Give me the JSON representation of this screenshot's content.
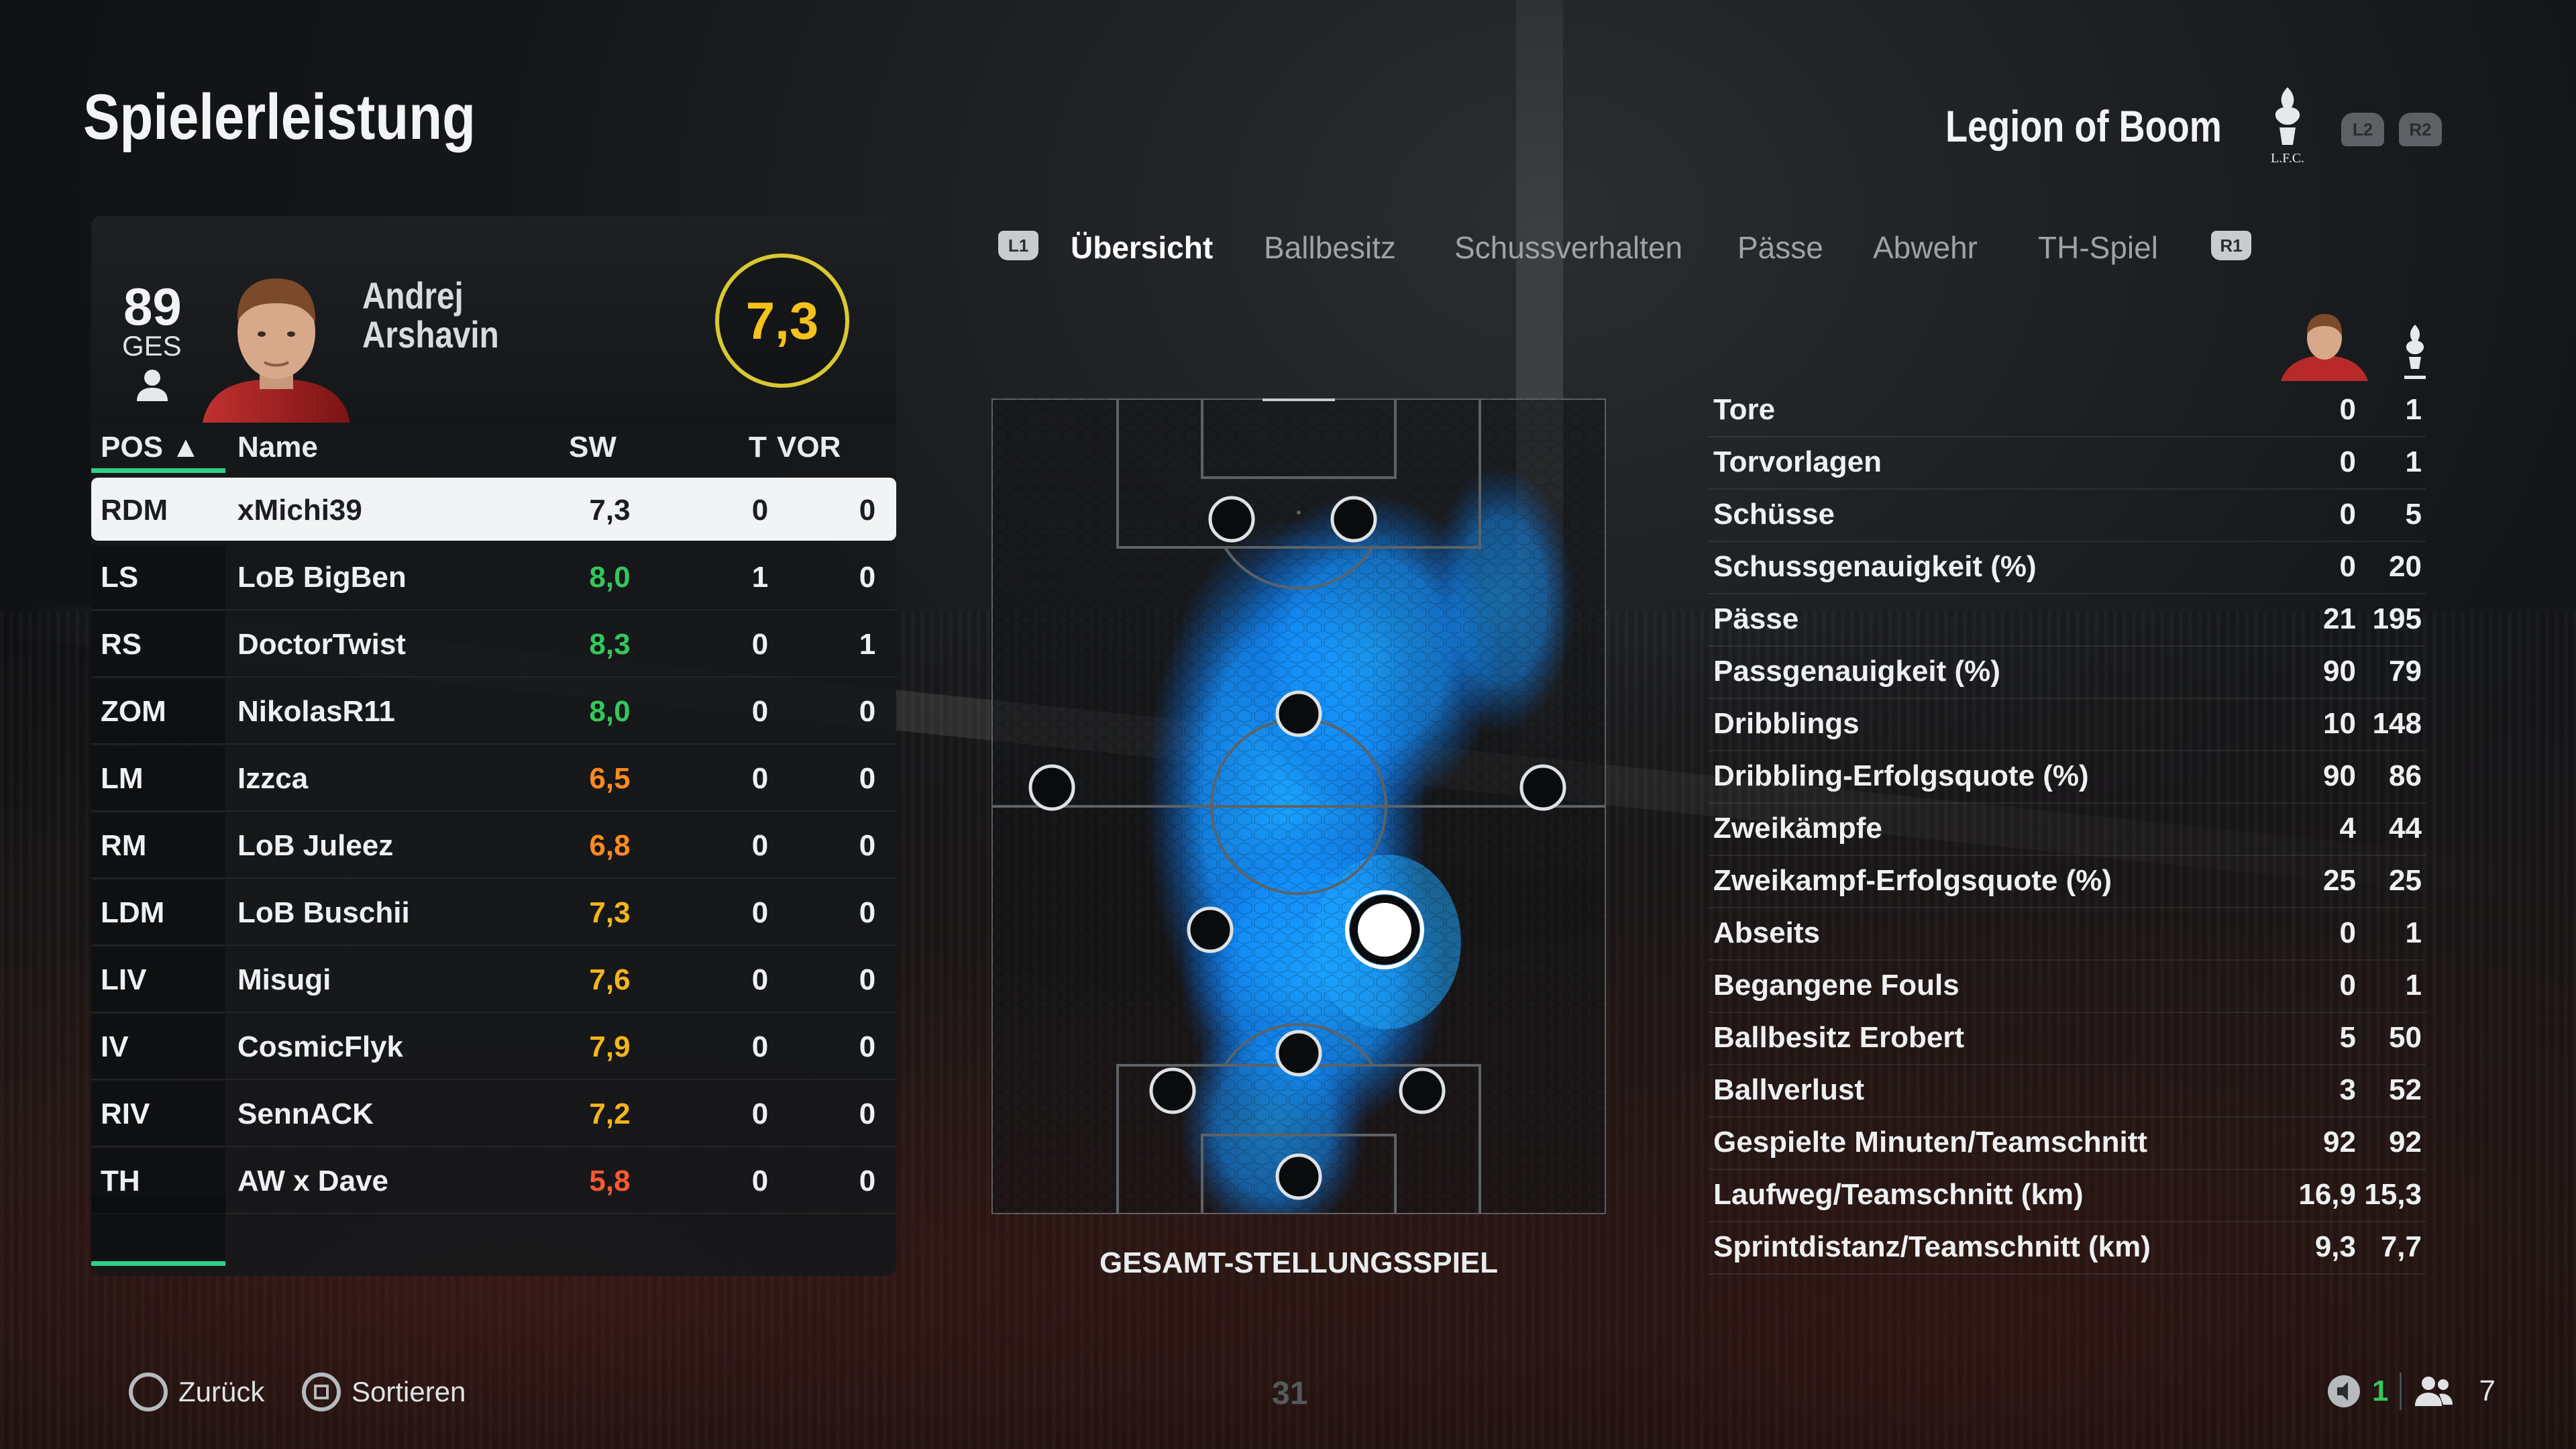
{
  "header": {
    "title": "Spielerleistung",
    "team_name": "Legion of Boom",
    "crest_text": "L.F.C.",
    "shoulder_left": "L2",
    "shoulder_right": "R2"
  },
  "player": {
    "overall": "89",
    "overall_label": "GES",
    "first_name": "Andrej",
    "last_name": "Arshavin",
    "rating": "7,3"
  },
  "table": {
    "columns": {
      "pos": "POS ▲",
      "name": "Name",
      "sw": "SW",
      "t": "T",
      "vor": "VOR"
    },
    "rows": [
      {
        "pos": "RDM",
        "name": "xMichi39",
        "sw": "7,3",
        "t": "0",
        "vor": "0"
      },
      {
        "pos": "LS",
        "name": "LoB BigBen",
        "sw": "8,0",
        "t": "1",
        "vor": "0"
      },
      {
        "pos": "RS",
        "name": "DoctorTwist",
        "sw": "8,3",
        "t": "0",
        "vor": "1"
      },
      {
        "pos": "ZOM",
        "name": "NikolasR11",
        "sw": "8,0",
        "t": "0",
        "vor": "0"
      },
      {
        "pos": "LM",
        "name": "Izzca",
        "sw": "6,5",
        "t": "0",
        "vor": "0"
      },
      {
        "pos": "RM",
        "name": "LoB Juleez",
        "sw": "6,8",
        "t": "0",
        "vor": "0"
      },
      {
        "pos": "LDM",
        "name": "LoB Buschii",
        "sw": "7,3",
        "t": "0",
        "vor": "0"
      },
      {
        "pos": "LIV",
        "name": "Misugi",
        "sw": "7,6",
        "t": "0",
        "vor": "0"
      },
      {
        "pos": "IV",
        "name": "CosmicFlyk",
        "sw": "7,9",
        "t": "0",
        "vor": "0"
      },
      {
        "pos": "RIV",
        "name": "SennACK",
        "sw": "7,2",
        "t": "0",
        "vor": "0"
      },
      {
        "pos": "TH",
        "name": "AW x Dave",
        "sw": "5,8",
        "t": "0",
        "vor": "0"
      }
    ]
  },
  "tabs": {
    "left_trigger": "L1",
    "right_trigger": "R1",
    "items": [
      "Übersicht",
      "Ballbesitz",
      "Schussverhalten",
      "Pässe",
      "Abwehr",
      "TH-Spiel"
    ]
  },
  "pitch": {
    "caption": "GESAMT-STELLUNGSSPIEL"
  },
  "stats": [
    {
      "label": "Tore",
      "player": "0",
      "team": "1"
    },
    {
      "label": "Torvorlagen",
      "player": "0",
      "team": "1"
    },
    {
      "label": "Schüsse",
      "player": "0",
      "team": "5"
    },
    {
      "label": "Schussgenauigkeit (%)",
      "player": "0",
      "team": "20"
    },
    {
      "label": "Pässe",
      "player": "21",
      "team": "195"
    },
    {
      "label": "Passgenauigkeit (%)",
      "player": "90",
      "team": "79"
    },
    {
      "label": "Dribblings",
      "player": "10",
      "team": "148"
    },
    {
      "label": "Dribbling-Erfolgsquote (%)",
      "player": "90",
      "team": "86"
    },
    {
      "label": "Zweikämpfe",
      "player": "4",
      "team": "44"
    },
    {
      "label": "Zweikampf-Erfolgsquote (%)",
      "player": "25",
      "team": "25"
    },
    {
      "label": "Abseits",
      "player": "0",
      "team": "1"
    },
    {
      "label": "Begangene Fouls",
      "player": "0",
      "team": "1"
    },
    {
      "label": "Ballbesitz Erobert",
      "player": "5",
      "team": "50"
    },
    {
      "label": "Ballverlust",
      "player": "3",
      "team": "52"
    },
    {
      "label": "Gespielte Minuten/Teamschnitt",
      "player": "92",
      "team": "92"
    },
    {
      "label": "Laufweg/Teamschnitt (km)",
      "player": "16,9",
      "team": "15,3"
    },
    {
      "label": "Sprintdistanz/Teamschnitt (km)",
      "player": "9,3",
      "team": "7,7"
    }
  ],
  "footer": {
    "back_label": "Zurück",
    "sort_label": "Sortieren",
    "page": "31",
    "count_green": "1",
    "count_users": "7"
  },
  "colors": {
    "accent_green": "#2fd08a",
    "rating_gold": "#f5c21a",
    "heatmap_blue": "#1aa3ff"
  }
}
